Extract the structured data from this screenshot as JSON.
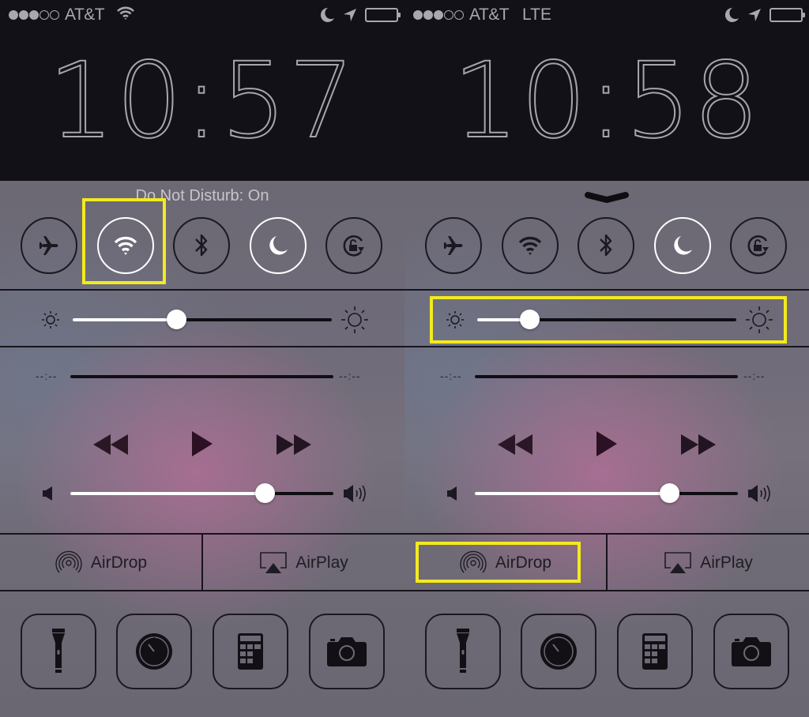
{
  "highlight_color": "#f3ea1f",
  "screens": [
    {
      "status": {
        "signal_bars": 3,
        "signal_total": 5,
        "carrier": "AT&T",
        "network": "wifi-icon",
        "icons": [
          "moon-icon",
          "location-arrow-icon",
          "battery-icon"
        ]
      },
      "clock": "10:57",
      "banner": "Do Not Disturb: On",
      "toggles": [
        {
          "name": "airplane-mode",
          "icon": "airplane-icon",
          "active": false
        },
        {
          "name": "wifi",
          "icon": "wifi-icon",
          "active": true
        },
        {
          "name": "bluetooth",
          "icon": "bluetooth-icon",
          "active": false
        },
        {
          "name": "do-not-disturb",
          "icon": "moon-icon",
          "active": true
        },
        {
          "name": "rotation-lock",
          "icon": "rotation-lock-icon",
          "active": false
        }
      ],
      "brightness": 0.4,
      "media": {
        "elapsed": "--:--",
        "remaining": "--:--",
        "volume": 0.74
      },
      "airdrop_label": "AirDrop",
      "airplay_label": "AirPlay",
      "shortcuts": [
        "flashlight-icon",
        "timer-icon",
        "calculator-icon",
        "camera-icon"
      ],
      "highlighted": "wifi-toggle"
    },
    {
      "status": {
        "signal_bars": 3,
        "signal_total": 5,
        "carrier": "AT&T",
        "network": "LTE",
        "icons": [
          "moon-icon",
          "location-arrow-icon",
          "battery-icon"
        ]
      },
      "clock": "10:58",
      "banner": "",
      "toggles": [
        {
          "name": "airplane-mode",
          "icon": "airplane-icon",
          "active": false
        },
        {
          "name": "wifi",
          "icon": "wifi-icon",
          "active": false
        },
        {
          "name": "bluetooth",
          "icon": "bluetooth-icon",
          "active": false
        },
        {
          "name": "do-not-disturb",
          "icon": "moon-icon",
          "active": true
        },
        {
          "name": "rotation-lock",
          "icon": "rotation-lock-icon",
          "active": false
        }
      ],
      "brightness": 0.2,
      "media": {
        "elapsed": "--:--",
        "remaining": "--:--",
        "volume": 0.74
      },
      "airdrop_label": "AirDrop",
      "airplay_label": "AirPlay",
      "shortcuts": [
        "flashlight-icon",
        "timer-icon",
        "calculator-icon",
        "camera-icon"
      ],
      "highlighted": "brightness-slider,airdrop-button"
    }
  ]
}
